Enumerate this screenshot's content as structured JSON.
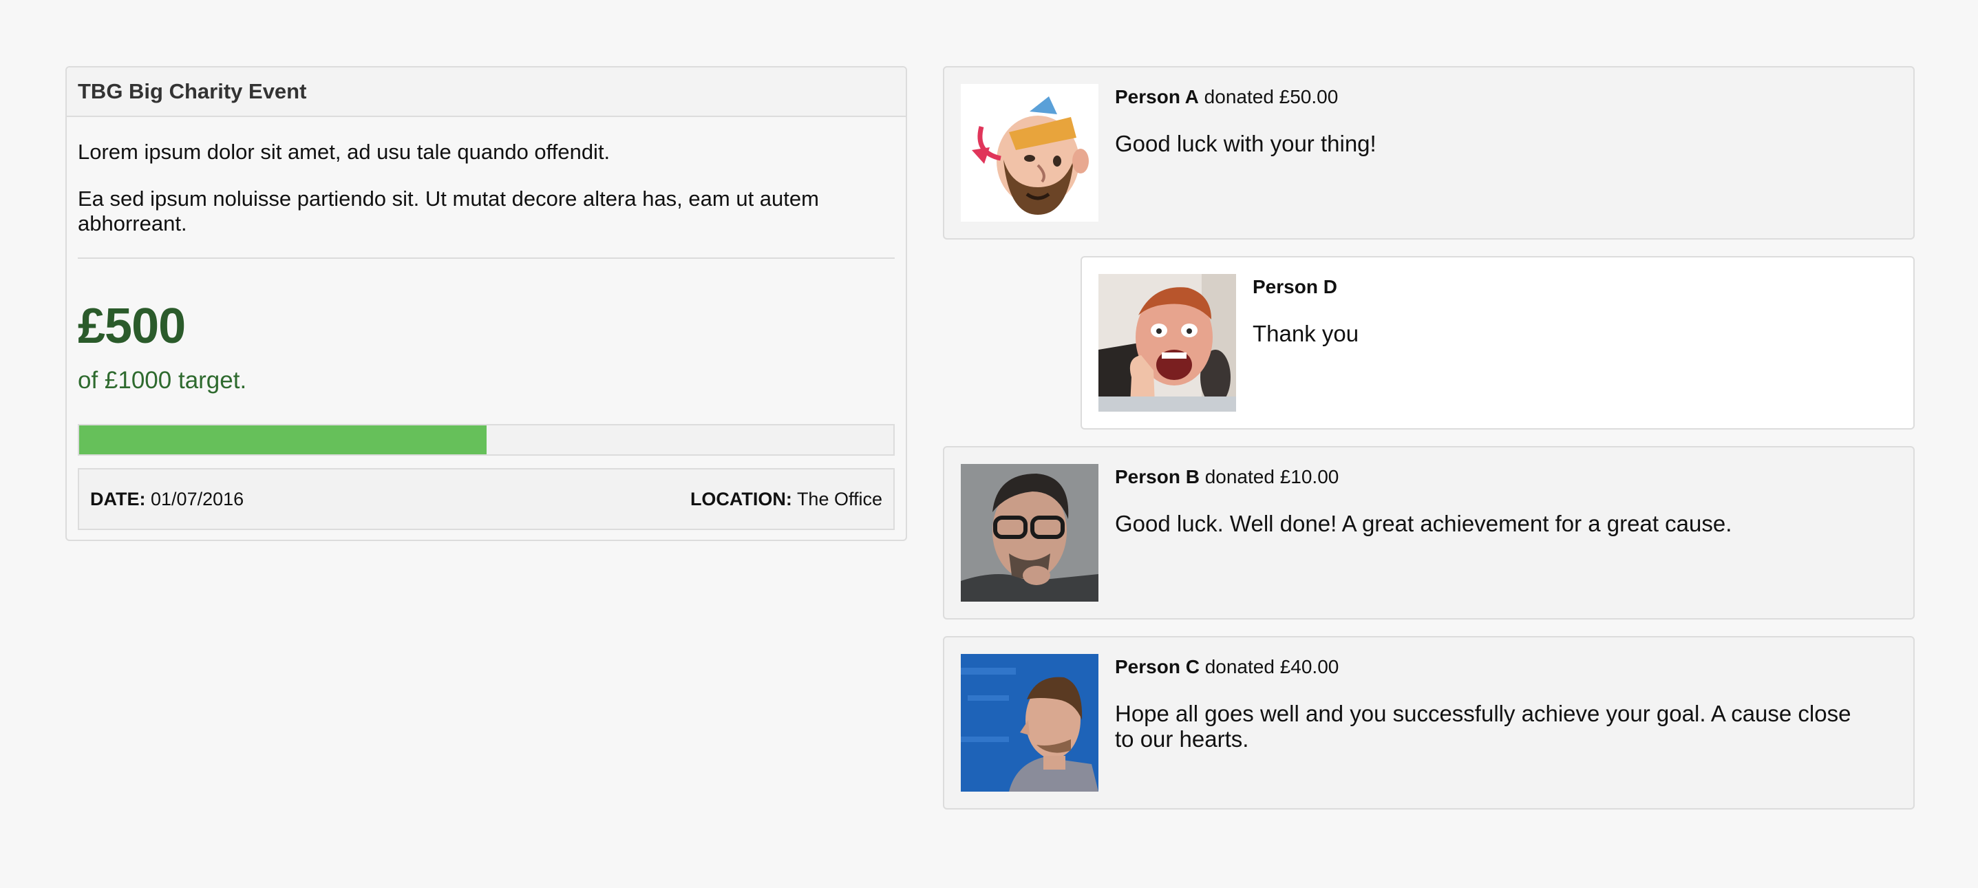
{
  "event": {
    "title": "TBG Big Charity Event",
    "paragraphs": [
      "Lorem ipsum dolor sit amet, ad usu tale quando offendit.",
      "Ea sed ipsum noluisse partiendo sit. Ut mutat decore altera has, eam ut autem abhorreant."
    ],
    "raised": "£500",
    "target_text": "of £1000 target.",
    "progress_fraction": 0.5,
    "date_label": "DATE:",
    "date_value": "01/07/2016",
    "location_label": "LOCATION:",
    "location_value": "The Office"
  },
  "colors": {
    "raised": "#2b5b2b",
    "progress_fill": "#66c05a"
  },
  "donations": [
    {
      "name": "Person A",
      "action": "donated £50.00",
      "message": "Good luck with your thing!",
      "avatar": "cartoon-avatar"
    },
    {
      "name": "Person D",
      "action": "",
      "message": "Thank you",
      "avatar": "photo-avatar",
      "reply": true
    },
    {
      "name": "Person B",
      "action": "donated £10.00",
      "message": "Good luck. Well done! A great achievement for a great cause.",
      "avatar": "photo-avatar"
    },
    {
      "name": "Person C",
      "action": "donated £40.00",
      "message": "Hope all goes well and you successfully achieve your goal. A cause close to our hearts.",
      "avatar": "photo-avatar"
    }
  ]
}
